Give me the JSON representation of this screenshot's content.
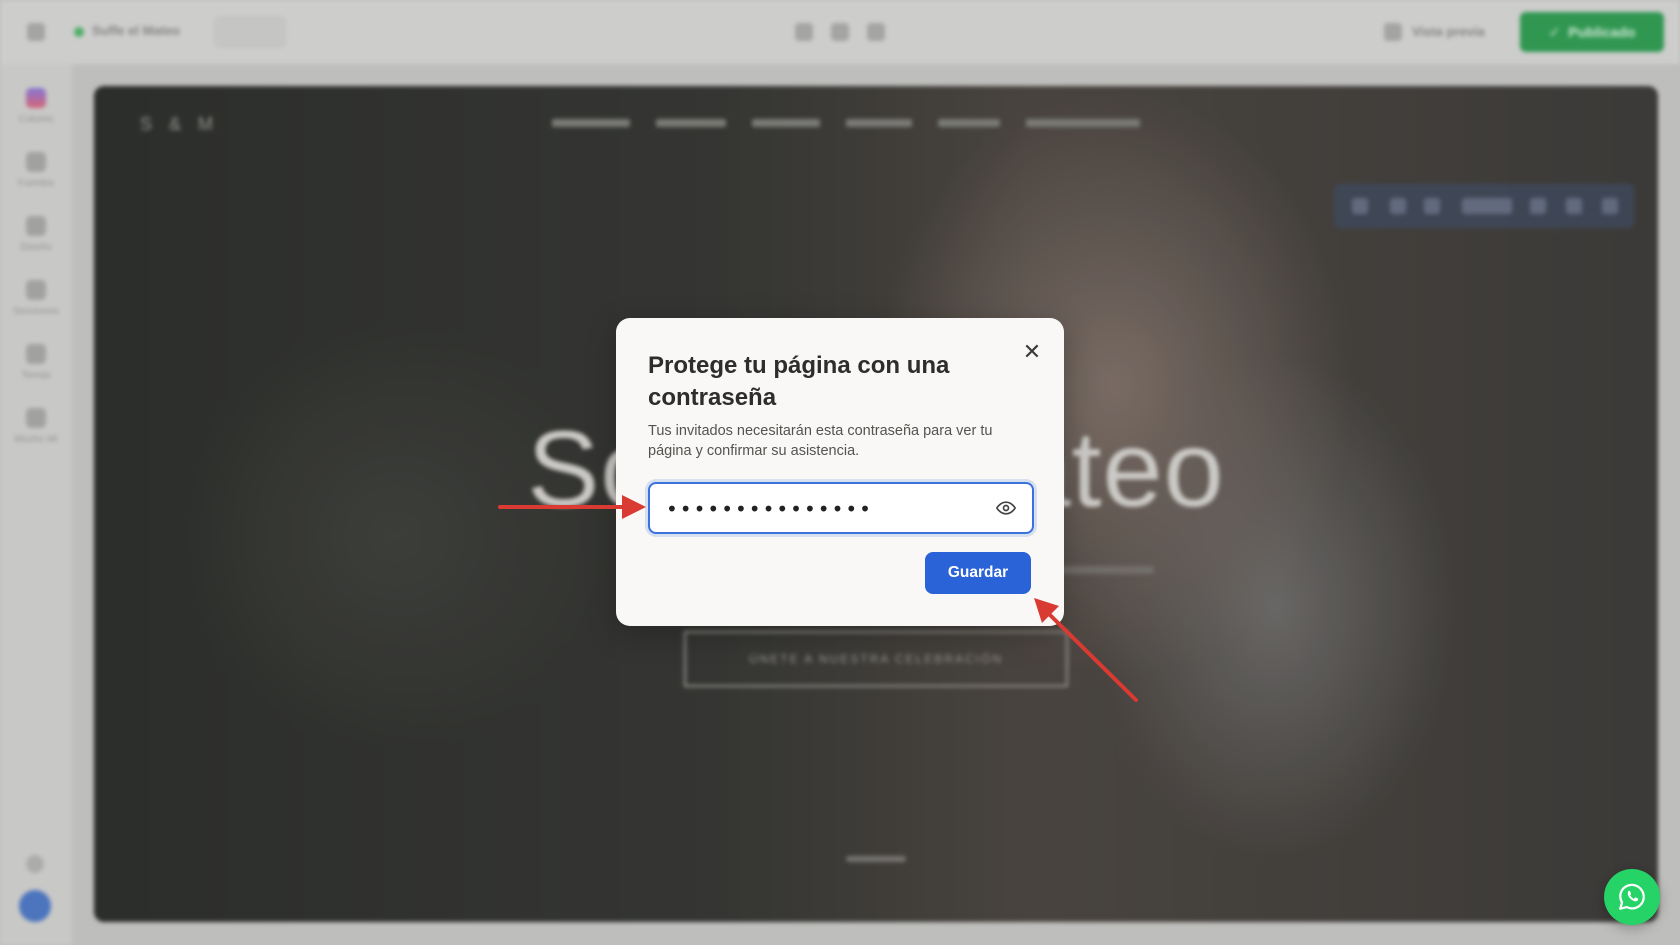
{
  "editor": {
    "status_text": "Suffe el Mateo",
    "preview_label": "Vista previa",
    "publish_label": "Publicado",
    "sidebar_items": [
      "Colores",
      "Fuentes",
      "Diseño",
      "Secciones",
      "Temas",
      "Mucho Mi"
    ],
    "site_logo": "S & M",
    "hero_title": "Sofía & Mateo",
    "hero_cta": "ÚNETE A NUESTRA CELEBRACIÓN"
  },
  "modal": {
    "title": "Protege tu página con una contraseña",
    "description": "Tus invitados necesitarán esta contraseña para ver tu página y confirmar su asistencia.",
    "password_value": "•••••••••••••••",
    "save_label": "Guardar",
    "close_symbol": "✕"
  },
  "icons": {
    "close": "close-icon",
    "eye": "eye-icon",
    "whatsapp": "whatsapp-icon"
  },
  "colors": {
    "primary": "#2a63d8",
    "annotation_arrow": "#d93a32",
    "whatsapp": "#25d366",
    "publish": "#1f8f43"
  }
}
